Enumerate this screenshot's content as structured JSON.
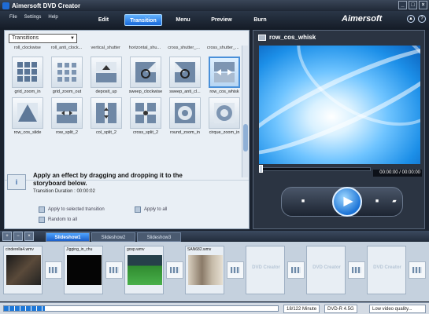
{
  "window": {
    "title": "Aimersoft DVD Creator",
    "controls": [
      "_",
      "□",
      "×"
    ]
  },
  "menu": {
    "file": "File",
    "settings": "Settings",
    "help": "Help"
  },
  "steps": [
    {
      "label": "Edit",
      "active": false
    },
    {
      "label": "Transition",
      "active": true
    },
    {
      "label": "Menu",
      "active": false
    },
    {
      "label": "Preview",
      "active": false
    },
    {
      "label": "Burn",
      "active": false
    }
  ],
  "brand": {
    "name": "Aimersoft",
    "icons": [
      "help-icon",
      "update-icon"
    ]
  },
  "transitions": {
    "dropdown_value": "Transitions",
    "top_row": [
      "roll_clockwise",
      "roll_anti_clock...",
      "vertical_shutter",
      "horizontal_shu...",
      "cross_shutter_...",
      "cross_shutter_..."
    ],
    "items": [
      {
        "label": "grid_zoom_in",
        "icon": "grid-icon"
      },
      {
        "label": "grid_zoom_out",
        "icon": "grid-icon"
      },
      {
        "label": "deposit_up",
        "icon": "arrow-up-icon"
      },
      {
        "label": "sweep_clockwise",
        "icon": "rotate-icon"
      },
      {
        "label": "sweep_anti_cl...",
        "icon": "rotate-icon"
      },
      {
        "label": "row_cos_whisk",
        "icon": "arrows-icon",
        "selected": true
      },
      {
        "label": "row_cos_slide",
        "icon": "triangle-icon"
      },
      {
        "label": "row_split_2",
        "icon": "split-icon"
      },
      {
        "label": "col_split_2",
        "icon": "split-icon"
      },
      {
        "label": "cross_split_2",
        "icon": "cross-icon"
      },
      {
        "label": "round_zoom_in",
        "icon": "circle-icon"
      },
      {
        "label": "cirque_zoom_in",
        "icon": "circle-icon"
      }
    ]
  },
  "info": {
    "title": "Apply an effect by dragging and dropping it to the storyboard below.",
    "duration": "Transition Duration : 00:00:02",
    "apply_selected": "Apply to selected transition",
    "apply_all": "Apply to all",
    "random_all": "Random to all"
  },
  "preview": {
    "title": "row_cos_whisk",
    "time": "00:00:00 / 00:00:00"
  },
  "storyboard": {
    "tabs": [
      "Slideshow1",
      "Slideshow2",
      "Slideshow3"
    ],
    "clips": [
      {
        "name": "cinderella4.wmv",
        "kind": "video-dark"
      },
      {
        "name": "Jigging_in_chu",
        "kind": "black"
      },
      {
        "name": "gosp.wmv",
        "kind": "field"
      },
      {
        "name": "SAN682.wmv",
        "kind": "room"
      },
      {
        "name": "",
        "kind": "empty",
        "text": "DVD Creator"
      },
      {
        "name": "",
        "kind": "empty",
        "text": "DVD Creator"
      },
      {
        "name": "",
        "kind": "empty",
        "text": "DVD Creator"
      }
    ]
  },
  "status": {
    "size": "18/122 Minute",
    "disc": "DVD-R 4.5G",
    "quality": "Low video quality..."
  }
}
